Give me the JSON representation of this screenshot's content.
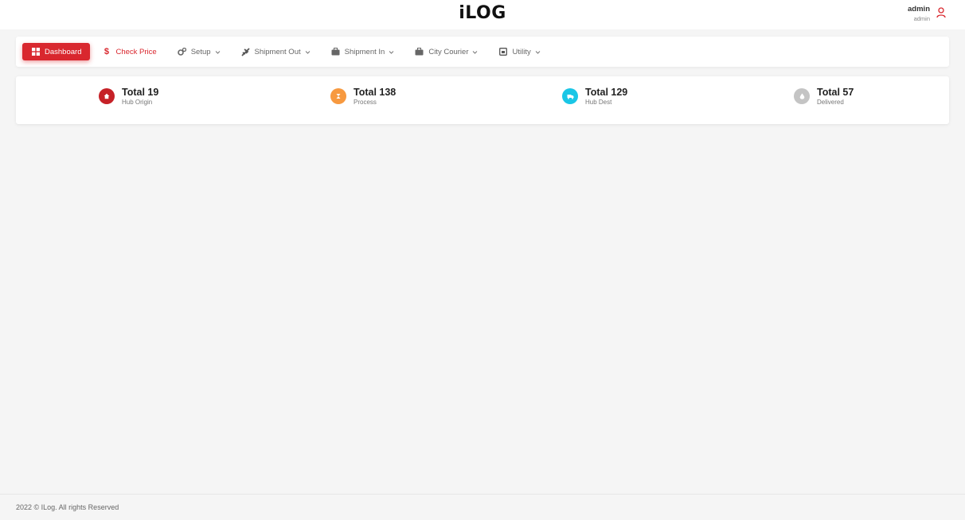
{
  "header": {
    "logo": "iLOG",
    "user": {
      "name": "admin",
      "role": "admin",
      "icon": "user-icon"
    }
  },
  "nav": {
    "items": [
      {
        "label": "Dashboard",
        "icon": "grid-icon"
      },
      {
        "label": "Check Price",
        "icon": "dollar-icon"
      },
      {
        "label": "Setup",
        "icon": "gears-icon"
      },
      {
        "label": "Shipment Out",
        "icon": "plane-icon"
      },
      {
        "label": "Shipment In",
        "icon": "briefcase-icon"
      },
      {
        "label": "City Courier",
        "icon": "briefcase-icon"
      },
      {
        "label": "Utility",
        "icon": "calendar-icon"
      }
    ]
  },
  "stats": [
    {
      "total": "Total 19",
      "label": "Hub Origin",
      "color": "#c62127",
      "icon": "home-icon"
    },
    {
      "total": "Total 138",
      "label": "Process",
      "color": "#f7993f",
      "icon": "hourglass-icon"
    },
    {
      "total": "Total 129",
      "label": "Hub Dest",
      "color": "#1ac6e6",
      "icon": "truck-icon"
    },
    {
      "total": "Total 57",
      "label": "Delivered",
      "color": "#c4c4c4",
      "icon": "drop-icon"
    }
  ],
  "colors": {
    "accent": "#d9272e",
    "background": "#f5f5f5"
  },
  "footer": {
    "text": "2022 © ILog. All rights Reserved"
  }
}
